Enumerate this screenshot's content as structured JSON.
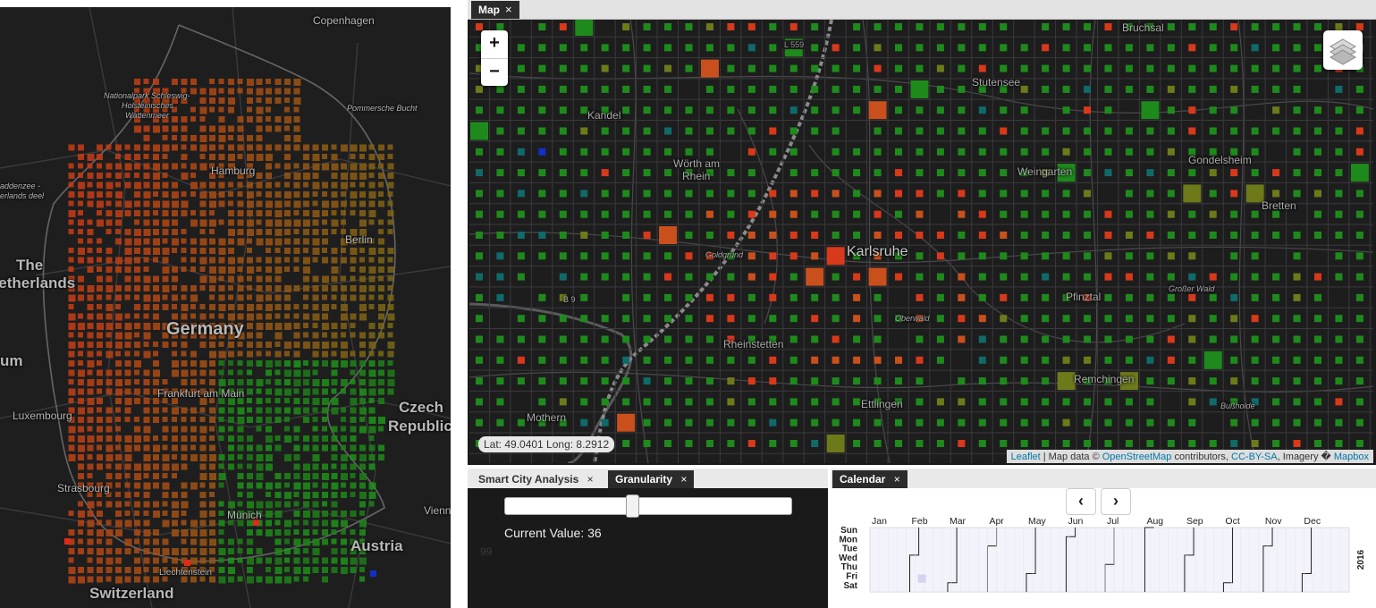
{
  "overview_map": {
    "labels": {
      "copenhagen": "Copenhagen",
      "np_schleswig": "Nationalpark Schleswig-",
      "np_holstein": "Holsteinisches",
      "np_wattenmeer": "Wattenmeer",
      "pommersche_bucht": "Pommersche Bucht",
      "hamburg": "Hamburg",
      "berlin": "Berlin",
      "the": "The",
      "netherlands": "Netherlands",
      "addenzee": "addenzee -",
      "erlands_deel": "erlands deel",
      "germany": "Germany",
      "um": "um",
      "frankfurt": "Frankfurt am Main",
      "luxembourg": "Luxembourg",
      "czech": "Czech",
      "republic": "Republic",
      "strasbourg": "Strasbourg",
      "munich": "Munich",
      "vienna": "Vienn",
      "austria": "Austria",
      "liechtenstein": "Liechtenstein",
      "switzerland": "Switzerland"
    }
  },
  "map_panel": {
    "tab_label": "Map",
    "tab_close": "×",
    "zoom_in": "+",
    "zoom_out": "−",
    "coords": "Lat: 49.0401 Long: 8.2912",
    "attribution": {
      "leaflet": "Leaflet",
      "sep1": " | Map data © ",
      "osm": "OpenStreetMap",
      "sep2": " contributors, ",
      "license": "CC-BY-SA",
      "sep3": ", Imagery � ",
      "mapbox": "Mapbox"
    },
    "labels": {
      "bruchsal": "Bruchsal",
      "stutensee": "Stutensee",
      "kandel": "Kandel",
      "woerth1": "Wörth am",
      "woerth2": "Rhein",
      "weingarten": "Weingarten",
      "gondelsheim": "Gondelsheim",
      "bretten": "Bretten",
      "goldgrund": "Goldgrund",
      "karlsruhe": "Karlsruhe",
      "pfinztal": "Pfinztal",
      "grosser_wald": "Großer Wald",
      "oberwald": "Oberwald",
      "rheinstetten": "Rheinstetten",
      "remchingen": "Remchingen",
      "ettlingen": "Ettlingen",
      "bussholde": "Bußholde",
      "mothern": "Mothern",
      "b9": "B 9",
      "l559": "L 559"
    }
  },
  "bottom_left": {
    "tabs": [
      {
        "label": "Smart City Analysis",
        "close": "×"
      },
      {
        "label": "Granularity",
        "close": "×"
      }
    ],
    "slider_fraction": 0.44,
    "current_value_label": "Current Value: 36",
    "faint_value": "99"
  },
  "calendar": {
    "tab_label": "Calendar",
    "tab_close": "×",
    "prev_label": "‹",
    "next_label": "›",
    "year": "2016",
    "months": [
      "Jan",
      "Feb",
      "Mar",
      "Apr",
      "May",
      "Jun",
      "Jul",
      "Aug",
      "Sep",
      "Oct",
      "Nov",
      "Dec"
    ],
    "weekdays": [
      "Sun",
      "Mon",
      "Tue",
      "Wed",
      "Thu",
      "Fri",
      "Sat"
    ]
  },
  "colors": {
    "cell_green": "#1f8a1c",
    "cell_red": "#d8391a",
    "cell_orange": "#c9501c",
    "cell_olive": "#6e7a1a",
    "cell_teal": "#106a6a",
    "cell_blue": "#1030c8",
    "link": "#0078a8"
  }
}
